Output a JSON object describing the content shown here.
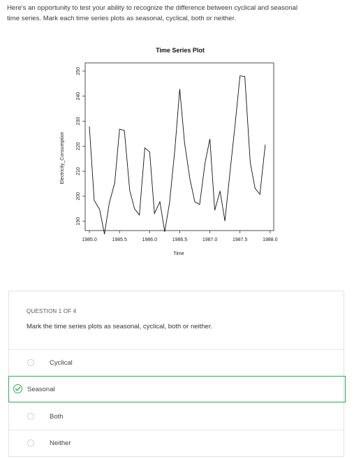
{
  "intro": {
    "line1": "Here's an opportunity to test your ability to recognize the difference between cyclical and seasonal",
    "line2": "time series. Mark each time series plots as seasonal, cyclical, both or neither."
  },
  "chart_data": {
    "type": "line",
    "title": "Time Series Plot",
    "xlabel": "Time",
    "ylabel": "Electricity_Consumption",
    "xlim": [
      1985.0,
      1988.0
    ],
    "ylim": [
      190,
      250
    ],
    "x_ticks": [
      "1985.0",
      "1985.5",
      "1986.0",
      "1986.5",
      "1987.0",
      "1987.5",
      "1988.0"
    ],
    "y_ticks": [
      "190",
      "200",
      "210",
      "220",
      "230",
      "240",
      "250"
    ],
    "grid": false,
    "x": [
      1985.0,
      1985.08,
      1985.17,
      1985.25,
      1985.33,
      1985.42,
      1985.5,
      1985.58,
      1985.67,
      1985.75,
      1985.83,
      1985.92,
      1986.0,
      1986.08,
      1986.17,
      1986.25,
      1986.33,
      1986.42,
      1986.5,
      1986.58,
      1986.67,
      1986.75,
      1986.83,
      1986.92,
      1987.0,
      1987.08,
      1987.17,
      1987.25,
      1987.33,
      1987.42,
      1987.5,
      1987.58,
      1987.67,
      1987.75,
      1987.83,
      1987.92
    ],
    "series": [
      {
        "values": [
          227.9,
          198.4,
          194.7,
          184.9,
          197.3,
          205.3,
          226.8,
          226.3,
          202.3,
          195.0,
          192.5,
          219.3,
          217.8,
          193.1,
          197.8,
          185.8,
          197.4,
          218.9,
          242.9,
          221.4,
          206.7,
          197.8,
          196.7,
          213.4,
          222.9,
          194.4,
          202.1,
          190.1,
          208.6,
          228.9,
          248.1,
          247.8,
          213.5,
          203.2,
          200.8,
          220.6
        ]
      }
    ]
  },
  "question": {
    "number_label": "QUESTION 1 OF 4",
    "prompt": "Mark the time series plots as seasonal, cyclical, both or neither."
  },
  "options": [
    {
      "label": "Cyclical",
      "selected": false
    },
    {
      "label": "Seasonal",
      "selected": true
    },
    {
      "label": "Both",
      "selected": false
    },
    {
      "label": "Neither",
      "selected": false
    }
  ],
  "colors": {
    "selected_accent": "#3aa655",
    "card_border": "#e2e2e2"
  },
  "icons": {
    "selected_check": "check-circle-icon",
    "unselected": "radio-circle-icon"
  }
}
